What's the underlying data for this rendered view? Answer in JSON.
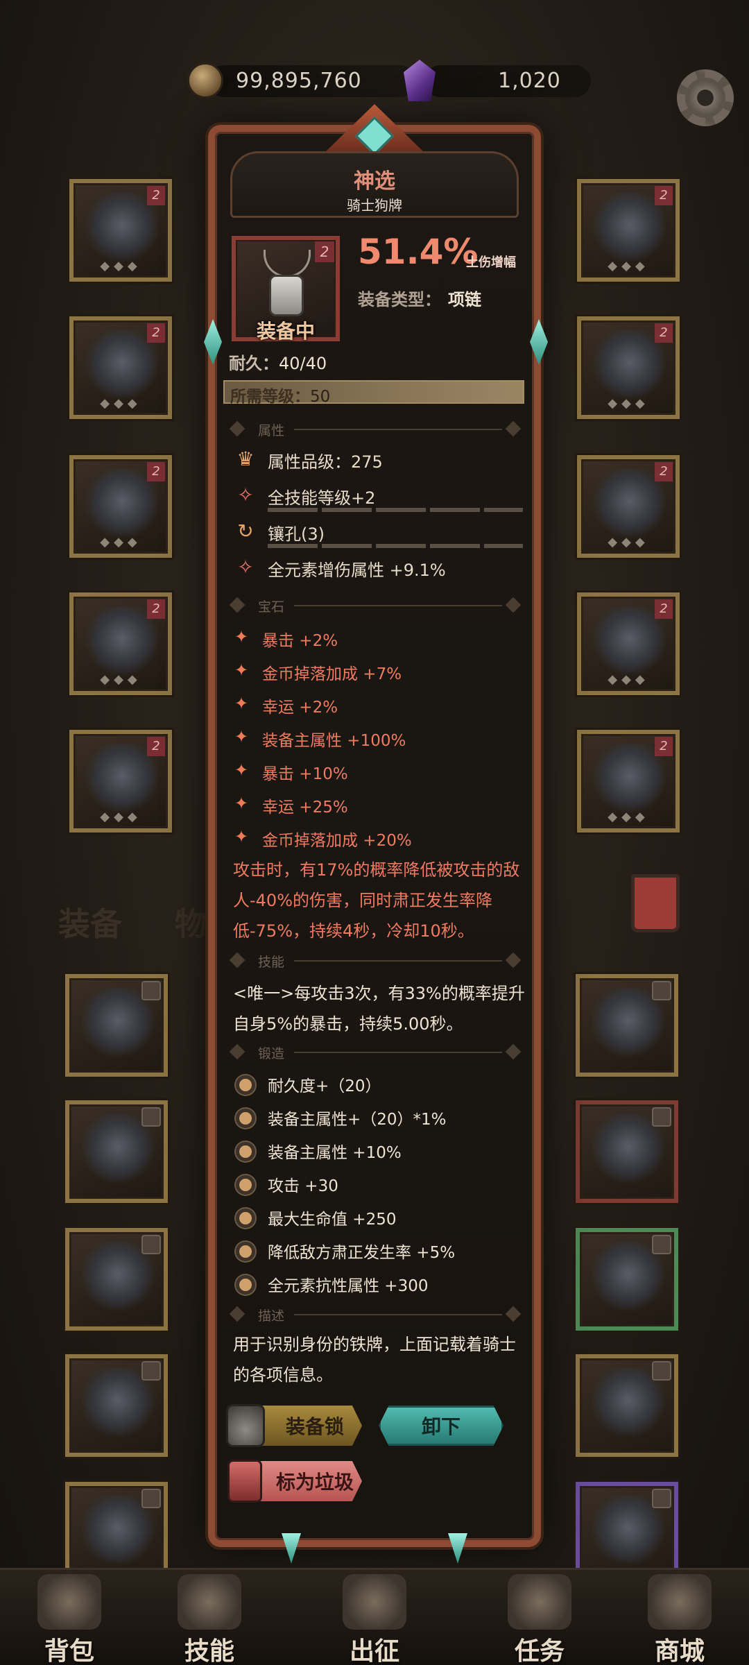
{
  "currency": {
    "gold": {
      "icon": "gold-coin-icon",
      "value": "99,895,760"
    },
    "gems": {
      "icon": "purple-crystal-icon",
      "value": "1,020"
    }
  },
  "settings_icon": "gear-icon",
  "background": {
    "tab_equipment": "装备",
    "tab_items": "物品"
  },
  "item_detail": {
    "name": "神选",
    "subtitle": "骑士狗牌",
    "level_badge": "2",
    "equipped_label": "装备中",
    "damage_value": "51.4%",
    "damage_label": "土伤增幅",
    "type_label": "装备类型：",
    "type_value": "项链",
    "durability_label": "耐久：",
    "durability_value": "40/40",
    "required_level_label": "所需等级：",
    "required_level_value": "50",
    "sections": {
      "attributes": "属性",
      "gems": "宝石",
      "skills": "技能",
      "forging": "锻造",
      "description": "描述"
    },
    "attributes": [
      "属性品级：275",
      "全技能等级+2",
      "镶孔(3)",
      "全元素增伤属性 +9.1%"
    ],
    "gem_bonuses": [
      "暴击 +2%",
      "金币掉落加成 +7%",
      "幸运 +2%",
      "装备主属性 +100%",
      "暴击 +10%",
      "幸运 +25%",
      "金币掉落加成 +20%"
    ],
    "gem_effect": "攻击时，有17%的概率降低被攻击的敌人-40%的伤害，同时肃正发生率降低-75%，持续4秒，冷却10秒。",
    "skill_text": "<唯一>每攻击3次，有33%的概率提升自身5%的暴击，持续5.00秒。",
    "forging": [
      "耐久度+（20）",
      "装备主属性+（20）*1%",
      "装备主属性 +10%",
      "攻击 +30",
      "最大生命值 +250",
      "降低敌方肃正发生率 +5%",
      "全元素抗性属性 +300"
    ],
    "description": "用于识别身份的铁牌，上面记载着骑士的各项信息。",
    "buttons": {
      "lock": "装备锁",
      "unequip": "卸下",
      "mark_trash": "标为垃圾"
    }
  },
  "bottom_nav": [
    {
      "label": "背包",
      "icon": "backpack-icon"
    },
    {
      "label": "技能",
      "icon": "skill-book-icon"
    },
    {
      "label": "出征",
      "icon": "expedition-icon"
    },
    {
      "label": "任务",
      "icon": "quest-scroll-icon"
    },
    {
      "label": "商城",
      "icon": "shop-icon"
    }
  ]
}
